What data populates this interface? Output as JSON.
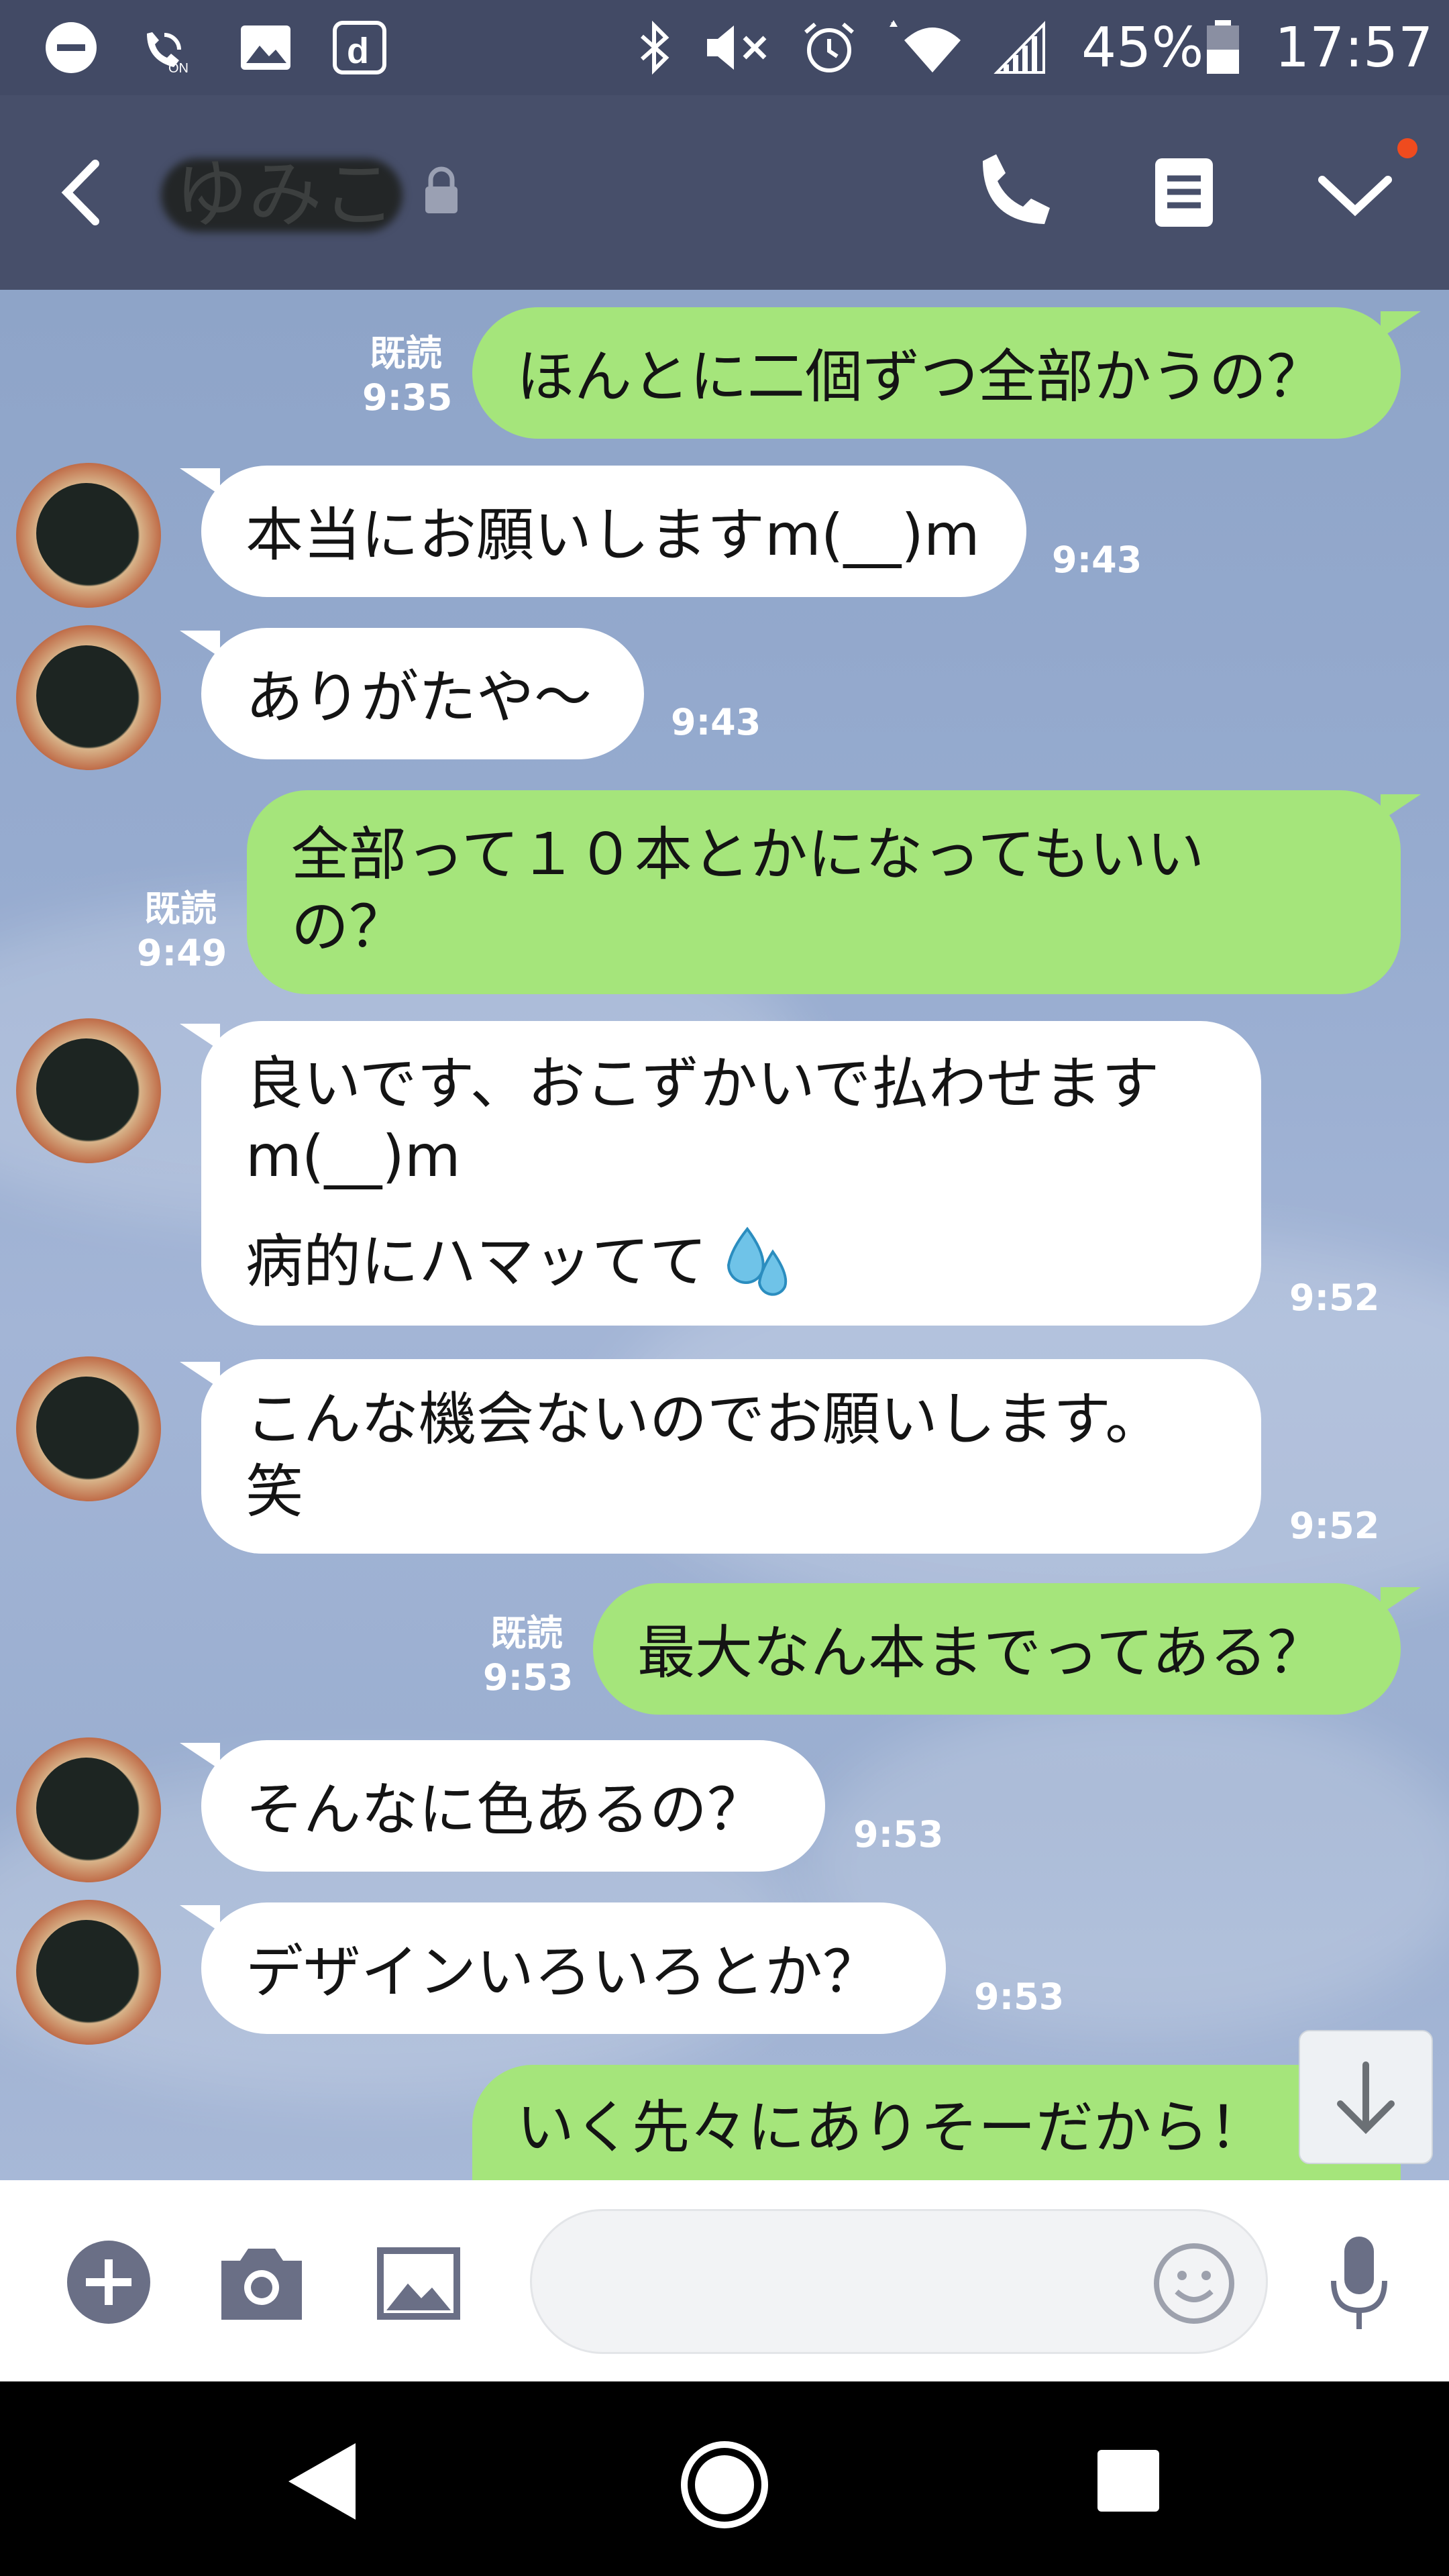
{
  "status_bar": {
    "icons": [
      "dnd-icon",
      "wifi-calling-icon",
      "gallery-icon",
      "docomo-d-icon",
      "bluetooth-icon",
      "mute-icon",
      "alarm-icon",
      "wifi-icon",
      "signal-icon",
      "battery-icon"
    ],
    "battery_percent": "45%",
    "clock": "17:57"
  },
  "header": {
    "contact_name": "ゆみこ",
    "back_icon": "chevron-left-icon",
    "call_icon": "phone-icon",
    "notes_icon": "notes-icon",
    "menu_icon": "chevron-down-icon",
    "notification_dot_color": "#ef4b1e"
  },
  "messages": [
    {
      "dir": "out",
      "text": "ほんとに二個ずつ全部かうの？",
      "read": "既読",
      "time": "9:35"
    },
    {
      "dir": "in",
      "text": "本当にお願いしますm(__)m",
      "time": "9:43"
    },
    {
      "dir": "in",
      "text": "ありがたや～",
      "time": "9:43"
    },
    {
      "dir": "out",
      "text_lines": [
        "全部って１０本とかになってもいい",
        "の？"
      ],
      "read": "既読",
      "time": "9:49"
    },
    {
      "dir": "in",
      "text_lines": [
        "良いです、おこずかいで払わせます",
        "m(__)m",
        "病的にハマッてて"
      ],
      "emoji": "sweat-drops-icon",
      "time": "9:52"
    },
    {
      "dir": "in",
      "text_lines": [
        "こんな機会ないのでお願いします。",
        "笑"
      ],
      "time": "9:52"
    },
    {
      "dir": "out",
      "text": "最大なん本までってある？",
      "read": "既読",
      "time": "9:53"
    },
    {
      "dir": "in",
      "text": "そんなに色あるの？",
      "time": "9:53"
    },
    {
      "dir": "in",
      "text": "デザインいろいろとか？",
      "time": "9:53"
    },
    {
      "dir": "out",
      "text": "いく先々にありそーだから！",
      "partial": true
    }
  ],
  "scroll_button": {
    "icon": "arrow-down-icon"
  },
  "input_bar": {
    "icons": [
      "plus-icon",
      "camera-icon",
      "image-icon",
      "emoji-icon",
      "microphone-icon"
    ],
    "placeholder": ""
  },
  "nav_bar": {
    "icons": [
      "back-triangle-icon",
      "home-circle-icon",
      "recents-square-icon"
    ]
  },
  "colors": {
    "outgoing_bubble": "#a5e57b",
    "incoming_bubble": "#ffffff",
    "header_bg": "#474f6a"
  }
}
